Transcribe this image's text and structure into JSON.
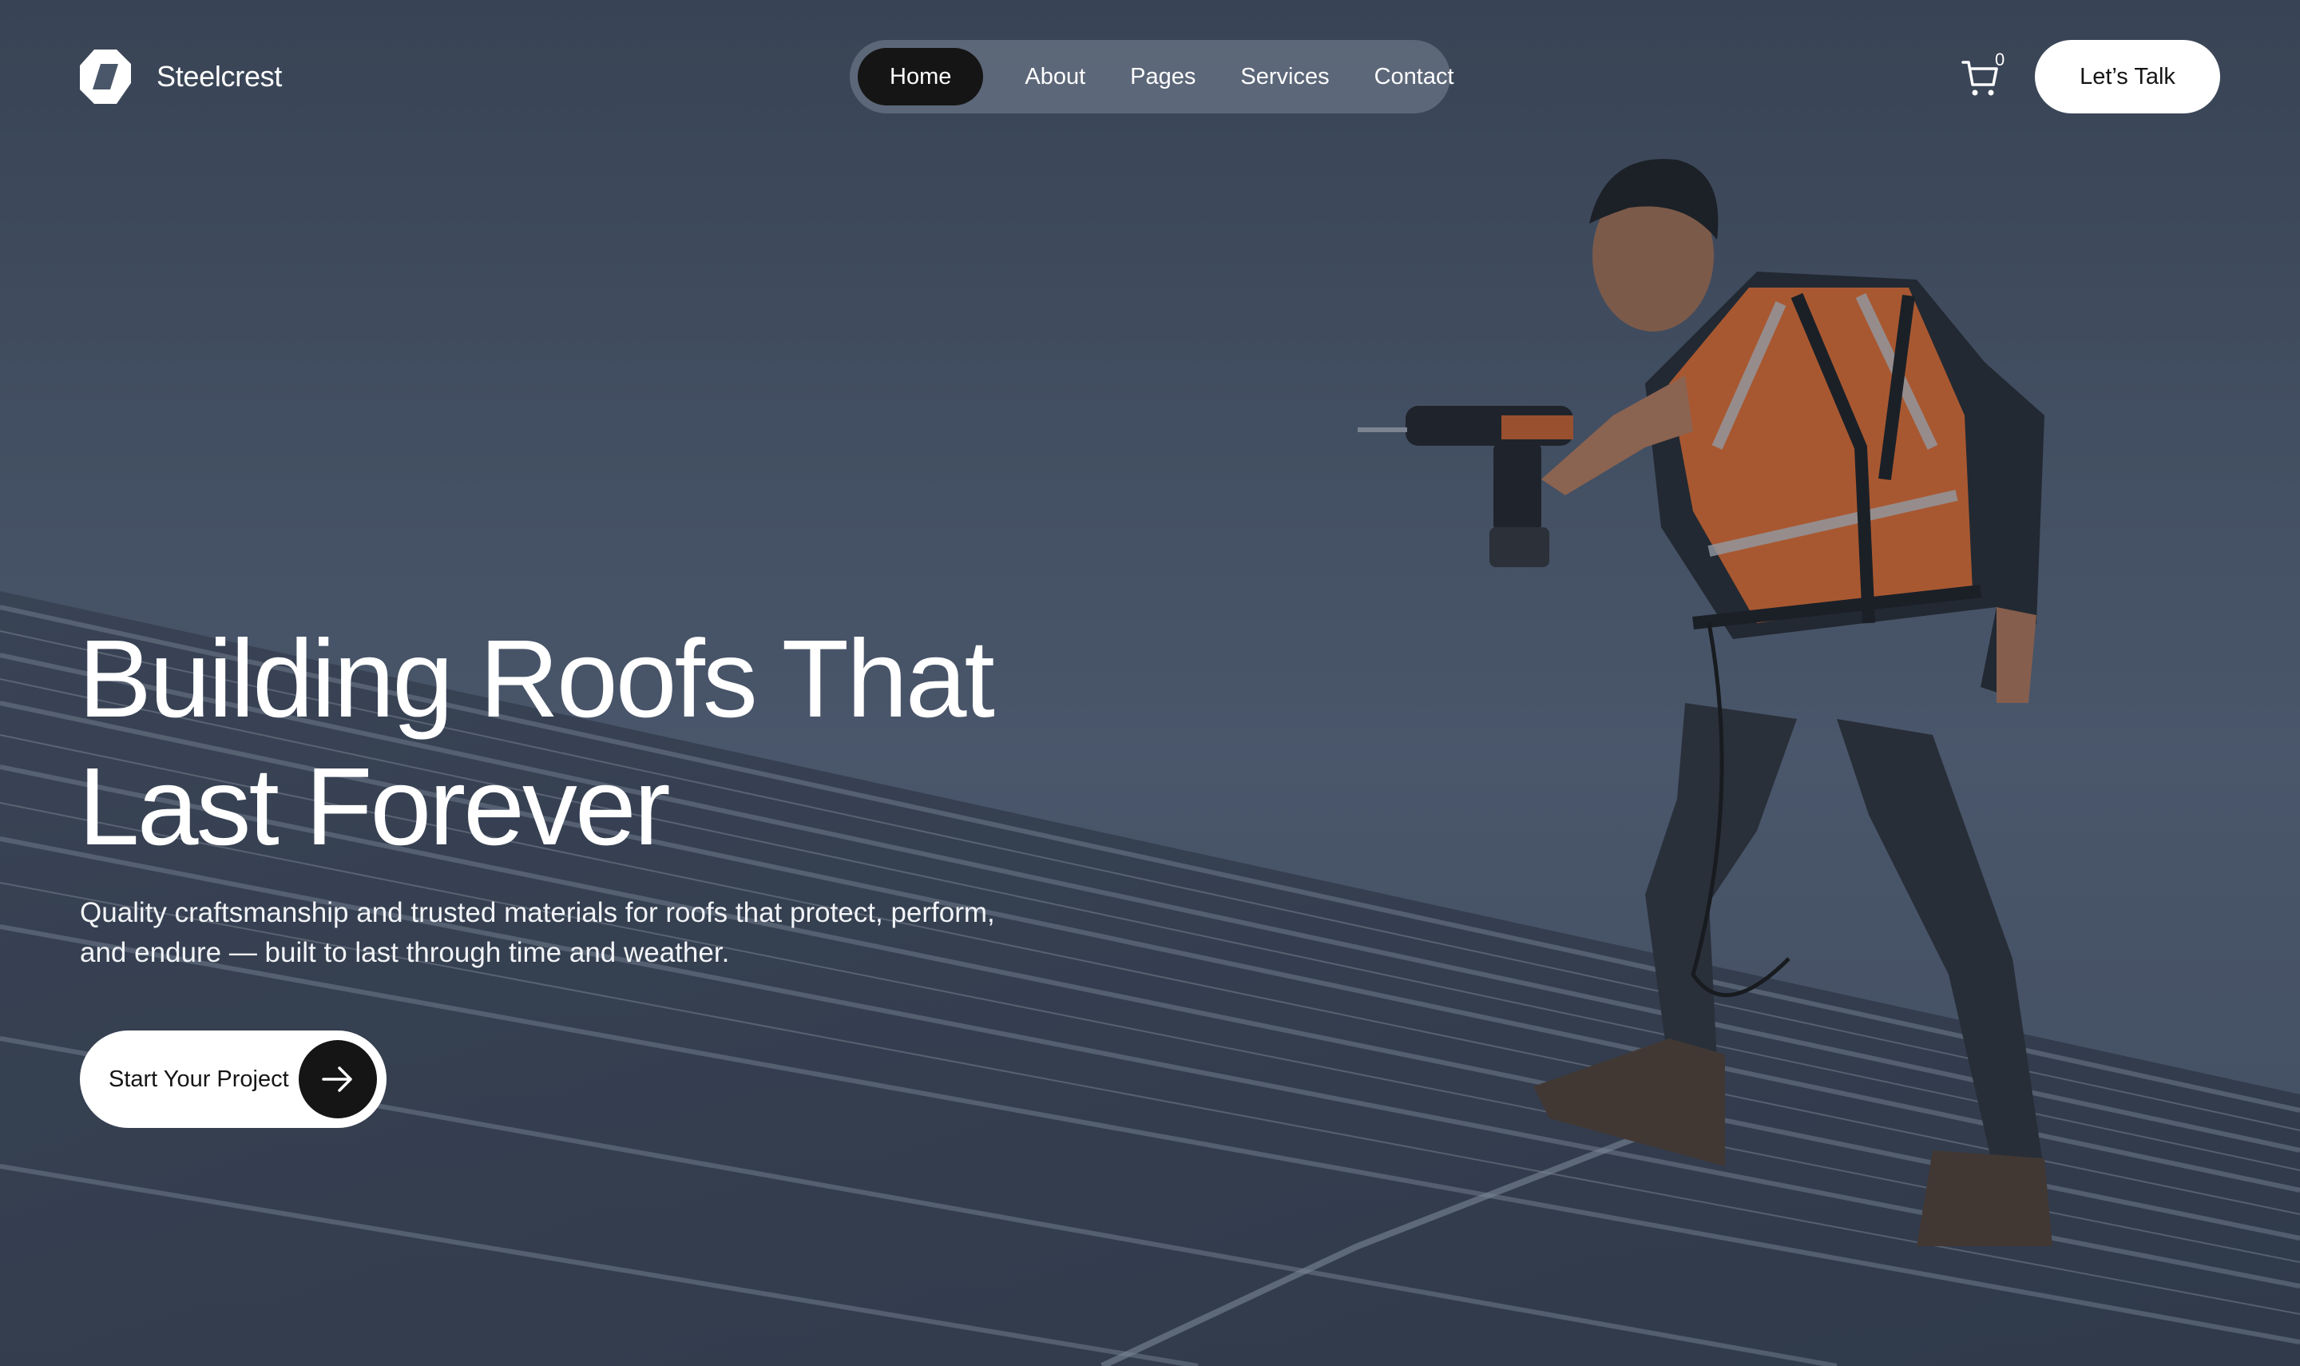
{
  "brand": {
    "name": "Steelcrest",
    "logo_icon": "hexagon-logo-icon"
  },
  "nav": {
    "items": [
      {
        "label": "Home",
        "active": true
      },
      {
        "label": "About",
        "active": false
      },
      {
        "label": "Pages",
        "active": false
      },
      {
        "label": "Services",
        "active": false
      },
      {
        "label": "Contact",
        "active": false
      }
    ]
  },
  "cart": {
    "icon": "cart-icon",
    "count": "0"
  },
  "header_cta": {
    "label": "Let’s Talk"
  },
  "hero": {
    "headline_line1": "Building Roofs That",
    "headline_line2": "Last Forever",
    "subtitle_line1": "Quality craftsmanship and trusted materials for roofs that protect, perform,",
    "subtitle_line2": "and endure — built to last through time and weather.",
    "cta_label": "Start Your Project",
    "cta_icon": "arrow-right-icon",
    "background": "roofer-with-drill-on-metal-roof-photo"
  },
  "colors": {
    "overlay": "#3f4b5e",
    "button_dark": "#151515",
    "button_light": "#ffffff",
    "vest_orange": "#d9662a"
  }
}
